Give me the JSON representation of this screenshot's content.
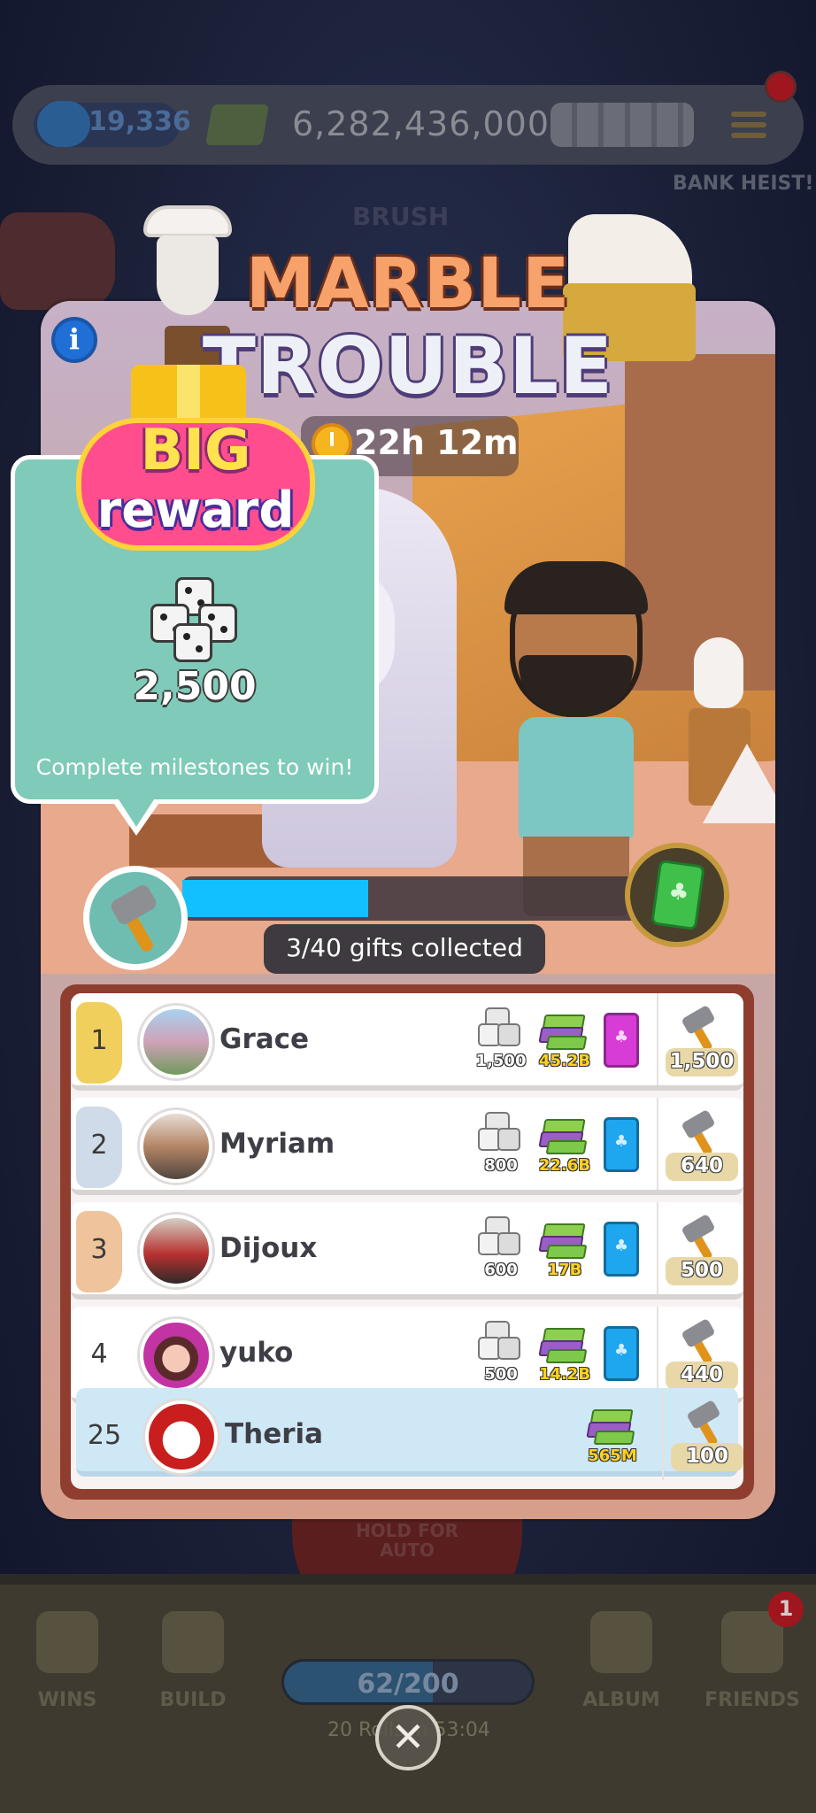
{
  "background": {
    "cash_counter": "19,336",
    "money_total": "6,282,436,000",
    "bank_heist_label": "BANK HEIST!",
    "brush_label": "BRUSH",
    "hold_for_auto": "HOLD FOR AUTO",
    "roll_counter": "62/200",
    "rolls_timer": "20 Rolls in 53:04",
    "nav": [
      "WINS",
      "BUILD",
      "ALBUM",
      "FRIENDS"
    ],
    "friends_badge": "1"
  },
  "event": {
    "title_line1": "MARBLE",
    "title_line2": "TROUBLE",
    "timer": "22h 12m",
    "info_label": "i"
  },
  "big_reward": {
    "line1": "BIG",
    "line2": "reward",
    "dice_amount": "2,500",
    "caption": "Complete milestones to win!"
  },
  "progress": {
    "collected": 3,
    "total": 40,
    "fraction": 0.41,
    "label": "3/40 gifts collected"
  },
  "leaderboard": [
    {
      "rank": "1",
      "name": "Grace",
      "dice": "1,500",
      "cash": "45.2B",
      "pack": "pink",
      "score": "1,500",
      "medal": "gold"
    },
    {
      "rank": "2",
      "name": "Myriam",
      "dice": "800",
      "cash": "22.6B",
      "pack": "blue",
      "score": "640",
      "medal": "silver"
    },
    {
      "rank": "3",
      "name": "Dijoux",
      "dice": "600",
      "cash": "17B",
      "pack": "blue",
      "score": "500",
      "medal": "bronze"
    },
    {
      "rank": "4",
      "name": "yuko",
      "dice": "500",
      "cash": "14.2B",
      "pack": "blue",
      "score": "440",
      "medal": ""
    },
    {
      "rank": "25",
      "name": "Theria",
      "dice": "",
      "cash": "565M",
      "pack": "",
      "score": "100",
      "medal": "",
      "is_me": true
    }
  ],
  "close_label": "✕",
  "colors": {
    "progress_fill": "#12c0ff",
    "board_frame": "#8f3d2f",
    "reward_card": "#7fcab8"
  }
}
